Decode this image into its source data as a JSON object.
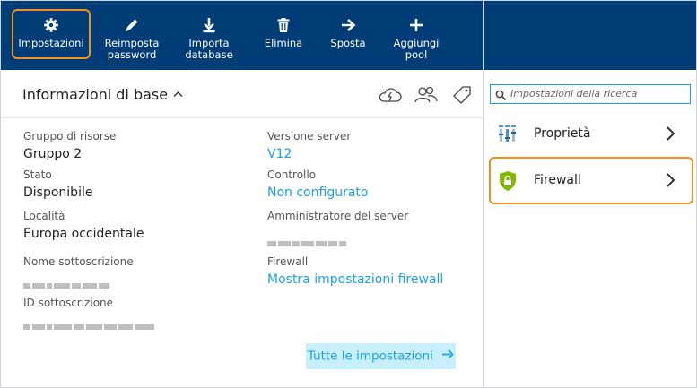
{
  "toolbar": {
    "items": [
      {
        "label": "Impostazioni",
        "icon": "gear-icon"
      },
      {
        "label": "Reimposta password",
        "icon": "pencil-icon"
      },
      {
        "label": "Importa database",
        "icon": "download-icon"
      },
      {
        "label": "Elimina",
        "icon": "trash-icon"
      },
      {
        "label": "Sposta",
        "icon": "arrow-right-icon"
      },
      {
        "label": "Aggiungi pool",
        "icon": "plus-icon"
      }
    ]
  },
  "essentials": {
    "title": "Informazioni di base",
    "fields": {
      "resource_group": {
        "label": "Gruppo di risorse",
        "value": "Gruppo 2"
      },
      "status": {
        "label": "Stato",
        "value": "Disponibile"
      },
      "location": {
        "label": "Località",
        "value": "Europa occidentale"
      },
      "subscription_name": {
        "label": "Nome sottoscrizione"
      },
      "subscription_id": {
        "label": "ID sottoscrizione"
      },
      "server_version": {
        "label": "Versione server",
        "value": "V12"
      },
      "audit": {
        "label": "Controllo",
        "value": "Non configurato"
      },
      "server_admin": {
        "label": "Amministratore del server"
      },
      "firewall": {
        "label": "Firewall",
        "value": "Mostra impostazioni firewall"
      }
    },
    "all_settings_label": "Tutte le impostazioni"
  },
  "settings_panel": {
    "search_placeholder": "Impostazioni della ricerca",
    "items": [
      {
        "label": "Proprietà",
        "icon": "properties-icon"
      },
      {
        "label": "Firewall",
        "icon": "shield-lock-icon"
      }
    ]
  },
  "colors": {
    "toolbar_bg": "#003c75",
    "link": "#1ba1e2",
    "highlight": "#f0901e",
    "button_bg": "#c7effc",
    "shield": "#7fba00"
  }
}
